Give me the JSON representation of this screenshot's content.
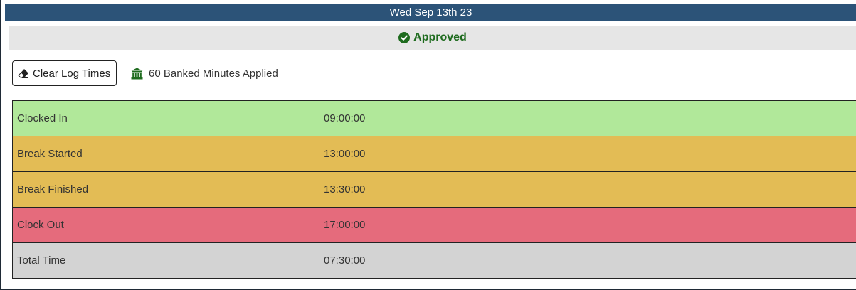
{
  "header": {
    "date": "Wed Sep 13th 23"
  },
  "status": {
    "label": "Approved",
    "icon": "check-circle-icon",
    "color": "#1e6b1e"
  },
  "toolbar": {
    "clear_label": "Clear Log Times",
    "clear_icon": "eraser-icon",
    "banked_label": "60 Banked Minutes Applied",
    "banked_icon": "bank-icon"
  },
  "log": {
    "rows": [
      {
        "label": "Clocked In",
        "time": "09:00:00",
        "color": "#b1e89a"
      },
      {
        "label": "Break Started",
        "time": "13:00:00",
        "color": "#e3bc55"
      },
      {
        "label": "Break Finished",
        "time": "13:30:00",
        "color": "#e3bc55"
      },
      {
        "label": "Clock Out",
        "time": "17:00:00",
        "color": "#e56b7c"
      },
      {
        "label": "Total Time",
        "time": "07:30:00",
        "color": "#d3d3d3"
      }
    ]
  }
}
